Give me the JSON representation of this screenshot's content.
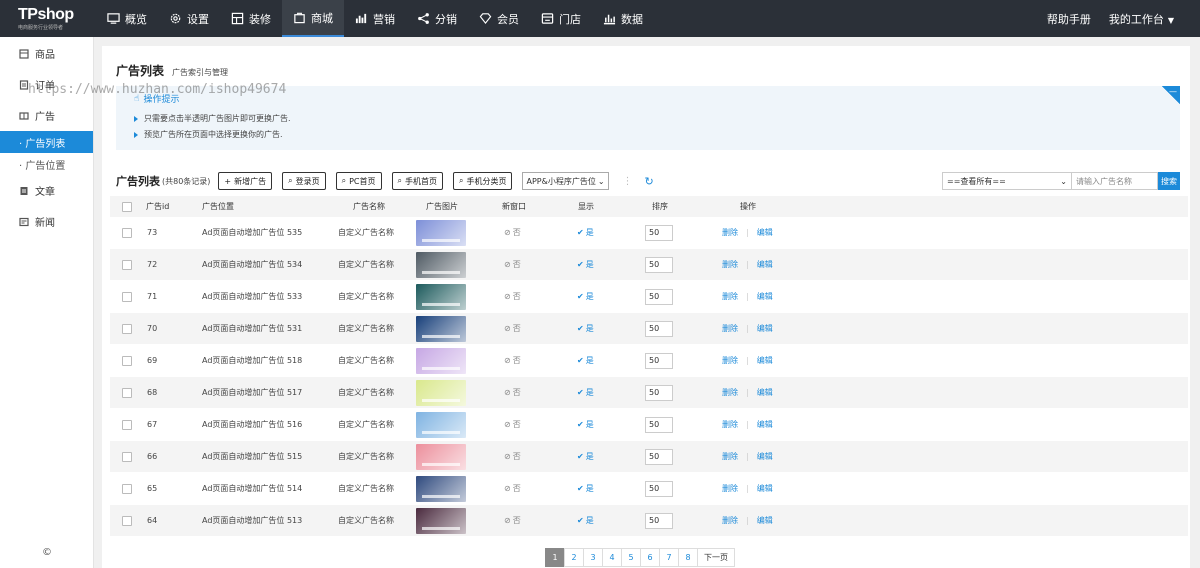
{
  "app": {
    "brand": "TPshop",
    "slogan": "电商服务行业领导者"
  },
  "topnav": [
    {
      "label": "概览",
      "icon": "monitor-icon",
      "active": false
    },
    {
      "label": "设置",
      "icon": "gear-icon",
      "active": false
    },
    {
      "label": "装修",
      "icon": "grid-icon",
      "active": false
    },
    {
      "label": "商城",
      "icon": "bag-icon",
      "active": true
    },
    {
      "label": "营销",
      "icon": "chart-icon",
      "active": false
    },
    {
      "label": "分销",
      "icon": "share-icon",
      "active": false
    },
    {
      "label": "会员",
      "icon": "diamond-icon",
      "active": false
    },
    {
      "label": "门店",
      "icon": "store-icon",
      "active": false
    },
    {
      "label": "数据",
      "icon": "bar-chart-icon",
      "active": false
    }
  ],
  "top_right": {
    "help": "帮助手册",
    "workspace": "我的工作台"
  },
  "sidebar": {
    "items": [
      {
        "type": "group",
        "label": "商品",
        "icon": "goods-icon"
      },
      {
        "type": "group",
        "label": "订单",
        "icon": "order-icon"
      },
      {
        "type": "group",
        "label": "广告",
        "icon": "ad-icon"
      },
      {
        "type": "sub",
        "label": "· 广告列表",
        "active": true
      },
      {
        "type": "sub",
        "label": "· 广告位置",
        "active": false
      },
      {
        "type": "group",
        "label": "文章",
        "icon": "article-icon"
      },
      {
        "type": "group",
        "label": "新闻",
        "icon": "news-icon"
      }
    ],
    "copyright": "©"
  },
  "header": {
    "title": "广告列表",
    "subtitle": "广告索引与管理"
  },
  "watermark": "https://www.huzhan.com/ishop49674",
  "tips": {
    "title": "操作提示",
    "lines": [
      "只需要点击半透明广告图片即可更换广告.",
      "预览广告所在页面中选择更换你的广告."
    ]
  },
  "toolbar": {
    "title": "广告列表",
    "count": "(共80条记录)",
    "buttons": [
      "新增广告",
      "登录页",
      "PC首页",
      "手机首页",
      "手机分类页"
    ],
    "position_select": "APP&小程序广告位",
    "filter_select": "==查看所有==",
    "search_placeholder": "请输入广告名称",
    "search_button": "搜索"
  },
  "columns": [
    "广告id",
    "广告位置",
    "广告名称",
    "广告图片",
    "新窗口",
    "显示",
    "排序",
    "操作"
  ],
  "rows": [
    {
      "id": "73",
      "position": "Ad页面自动增加广告位 535",
      "name": "自定义广告名称",
      "new_window": "否",
      "show": "是",
      "sort": "50",
      "thumb_color": "#7d8fd8"
    },
    {
      "id": "72",
      "position": "Ad页面自动增加广告位 534",
      "name": "自定义广告名称",
      "new_window": "否",
      "show": "是",
      "sort": "50",
      "thumb_color": "#4f5a63"
    },
    {
      "id": "71",
      "position": "Ad页面自动增加广告位 533",
      "name": "自定义广告名称",
      "new_window": "否",
      "show": "是",
      "sort": "50",
      "thumb_color": "#1c5a5c"
    },
    {
      "id": "70",
      "position": "Ad页面自动增加广告位 531",
      "name": "自定义广告名称",
      "new_window": "否",
      "show": "是",
      "sort": "50",
      "thumb_color": "#173f7a"
    },
    {
      "id": "69",
      "position": "Ad页面自动增加广告位 518",
      "name": "自定义广告名称",
      "new_window": "否",
      "show": "是",
      "sort": "50",
      "thumb_color": "#c6a7e4"
    },
    {
      "id": "68",
      "position": "Ad页面自动增加广告位 517",
      "name": "自定义广告名称",
      "new_window": "否",
      "show": "是",
      "sort": "50",
      "thumb_color": "#d9e88c"
    },
    {
      "id": "67",
      "position": "Ad页面自动增加广告位 516",
      "name": "自定义广告名称",
      "new_window": "否",
      "show": "是",
      "sort": "50",
      "thumb_color": "#7fb3e2"
    },
    {
      "id": "66",
      "position": "Ad页面自动增加广告位 515",
      "name": "自定义广告名称",
      "new_window": "否",
      "show": "是",
      "sort": "50",
      "thumb_color": "#ec8f9c"
    },
    {
      "id": "65",
      "position": "Ad页面自动增加广告位 514",
      "name": "自定义广告名称",
      "new_window": "否",
      "show": "是",
      "sort": "50",
      "thumb_color": "#2f4a7e"
    },
    {
      "id": "64",
      "position": "Ad页面自动增加广告位 513",
      "name": "自定义广告名称",
      "new_window": "否",
      "show": "是",
      "sort": "50",
      "thumb_color": "#4a2a3e"
    }
  ],
  "row_actions": {
    "delete": "删除",
    "edit": "编辑"
  },
  "pagination": {
    "pages": [
      "1",
      "2",
      "3",
      "4",
      "5",
      "6",
      "7",
      "8"
    ],
    "active": "1",
    "next": "下一页"
  },
  "colors": {
    "topbar": "#2b3038",
    "accent": "#1c8ad9",
    "tips_bg": "#eff5fa"
  }
}
